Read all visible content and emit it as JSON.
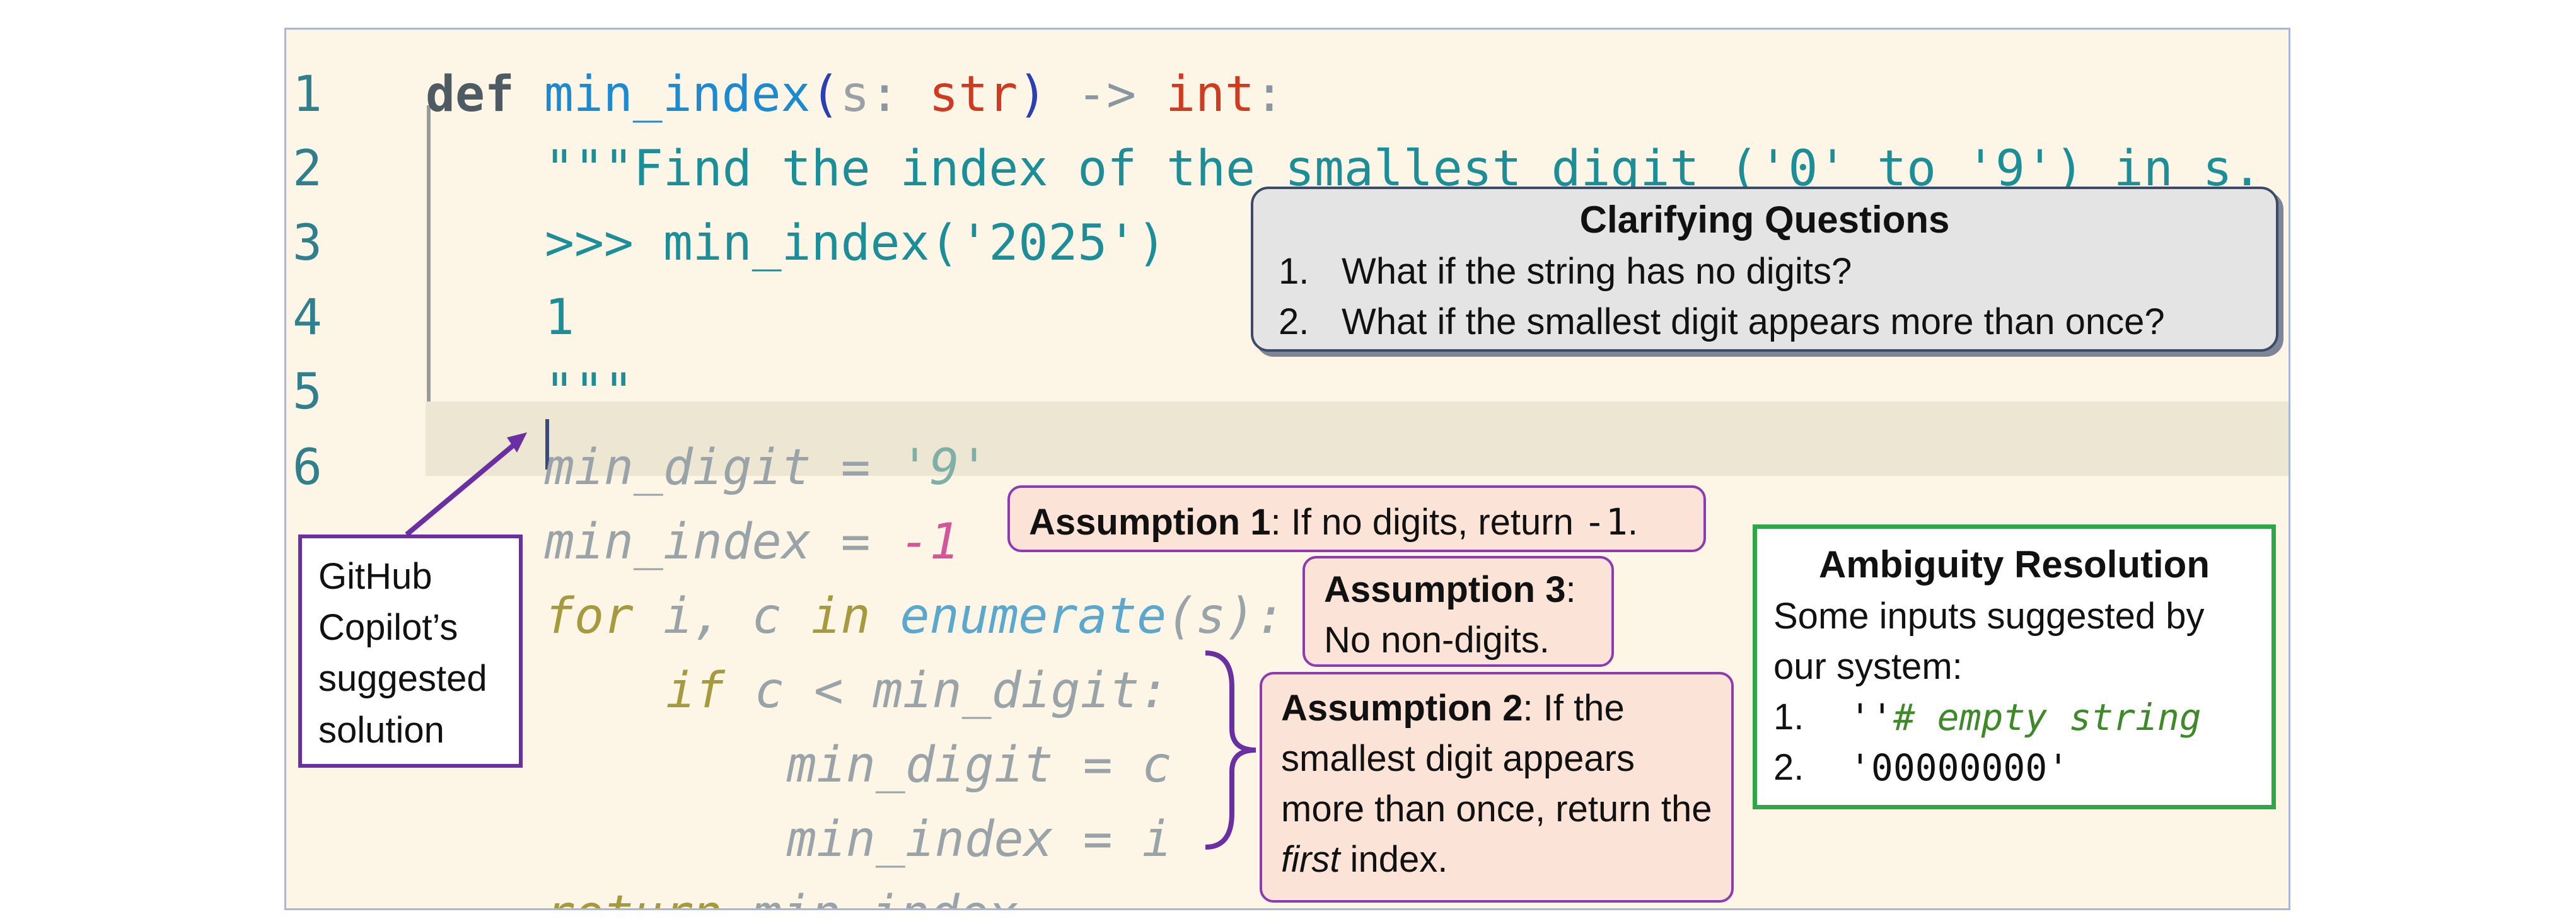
{
  "line_numbers": [
    "1",
    "2",
    "3",
    "4",
    "5",
    "6"
  ],
  "code": {
    "line1": {
      "def": "def",
      "fn": "min_index",
      "open": "(",
      "param": "s",
      "colon": ":",
      "type": "str",
      "close": ")",
      "arrow": "->",
      "ret": "int",
      "end": ":"
    },
    "line2": "\"\"\"Find the index of the smallest digit ('0' to '9') in s.",
    "line3": ">>> min_index('2025')",
    "line4": "1",
    "line5": "\"\"\"",
    "line6": {
      "var": "min_digit",
      "eq": "=",
      "val": "'9'"
    },
    "line7": {
      "var": "min_index",
      "eq": "=",
      "val": "-1"
    },
    "line8": {
      "for": "for",
      "vars": "i, c",
      "in": "in",
      "fn": "enumerate",
      "args": "(s):"
    },
    "line9": {
      "if": "if",
      "cond": "c < min_digit:"
    },
    "line10": "min_digit = c",
    "line11": "min_index = i",
    "line12": {
      "ret": "return",
      "val": "min_index"
    }
  },
  "clarifying": {
    "title": "Clarifying Questions",
    "items": [
      {
        "num": "1.",
        "text": "What if the string has no digits?"
      },
      {
        "num": "2.",
        "text": "What if the smallest digit appears more than once?"
      }
    ]
  },
  "assumption1": {
    "label": "Assumption 1",
    "text": ": If no digits, return ",
    "code": "-1",
    "end": "."
  },
  "assumption3": {
    "label": "Assumption 3",
    "colon": ":",
    "text": "No non-digits."
  },
  "assumption2": {
    "label": "Assumption 2",
    "text1": ": If the smallest digit appears more than once, return the ",
    "em": "first",
    "text2": " index."
  },
  "ambiguity": {
    "title": "Ambiguity Resolution",
    "intro": "Some inputs suggested by our system:",
    "items": [
      {
        "num": "1.",
        "code": "''",
        "comment": " # empty string"
      },
      {
        "num": "2.",
        "code": "'00000000'",
        "comment": ""
      }
    ]
  },
  "copilot_label": "GitHub Copilot’s suggested solution",
  "colors": {
    "editor_bg": "#fdf6e6",
    "clarify_border": "#3b4a66",
    "assumption_border": "#8e3ab1",
    "ambiguity_border": "#2fa64a",
    "copilot_border": "#6a2fa0"
  }
}
